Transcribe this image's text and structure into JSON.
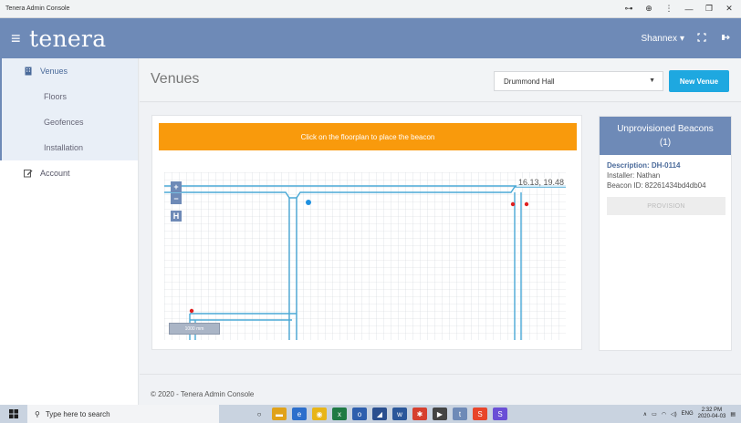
{
  "browser": {
    "title": "Tenera Admin Console",
    "controls": [
      "⊶",
      "⊕",
      "⋮",
      "—",
      "❐",
      "✕"
    ]
  },
  "header": {
    "brand": "tenera",
    "user": "Shannex",
    "user_caret": "▾"
  },
  "sidebar": {
    "items": [
      {
        "label": "Venues"
      },
      {
        "label": "Floors"
      },
      {
        "label": "Geofences"
      },
      {
        "label": "Installation"
      },
      {
        "label": "Account"
      }
    ]
  },
  "page": {
    "title": "Venues",
    "venue_selected": "Drummond Hall",
    "new_venue_label": "New Venue"
  },
  "floorplan": {
    "hint": "Click on the floorplan to place the beacon",
    "coordinates": "16.13, 19.48",
    "zoom_in": "+",
    "zoom_out": "−",
    "home": "H",
    "scale": "1000 mm"
  },
  "beacons": {
    "title": "Unprovisioned Beacons",
    "count": "(1)",
    "description": "Description: DH-0114",
    "installer": "Installer: Nathan",
    "beacon_id": "Beacon ID: 82261434bd4db04",
    "provision_label": "PROVISION"
  },
  "footer": {
    "text": "© 2020 - Tenera Admin Console"
  },
  "taskbar": {
    "search_placeholder": "Type here to search",
    "time": "2:32 PM",
    "date": "2020-04-03",
    "language": "ENG"
  },
  "colors": {
    "header": "#6e8ab7",
    "accent": "#1ea8e0",
    "hint": "#f99a0c",
    "wall": "#4aa9d6",
    "marker_red": "#e02020",
    "marker_blue": "#1e90e0"
  }
}
